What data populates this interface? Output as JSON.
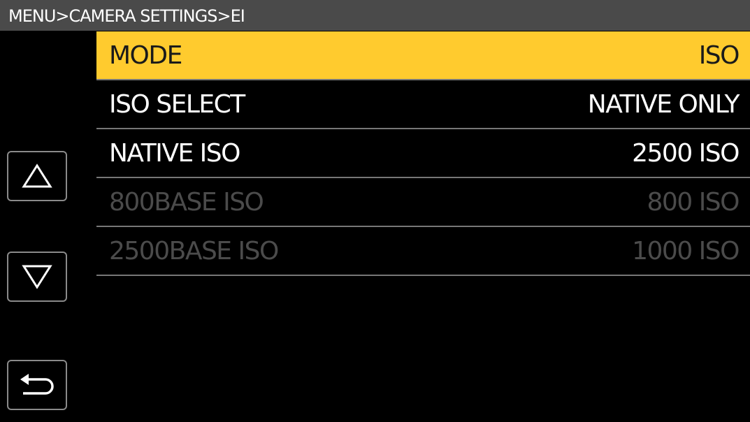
{
  "header": {
    "breadcrumb": "MENU>CAMERA SETTINGS>EI"
  },
  "menu": {
    "items": [
      {
        "label": "MODE",
        "value": "ISO",
        "state": "selected"
      },
      {
        "label": "ISO SELECT",
        "value": "NATIVE ONLY",
        "state": "enabled"
      },
      {
        "label": "NATIVE ISO",
        "value": "2500 ISO",
        "state": "enabled"
      },
      {
        "label": "800BASE ISO",
        "value": "800 ISO",
        "state": "disabled"
      },
      {
        "label": "2500BASE ISO",
        "value": "1000 ISO",
        "state": "disabled"
      }
    ]
  },
  "side_buttons": {
    "up_icon": "triangle-up-icon",
    "down_icon": "triangle-down-icon",
    "back_icon": "return-arrow-icon"
  },
  "colors": {
    "header_bg": "#4a4a4a",
    "selected_bg": "#ffcb2e",
    "disabled_text": "#4b4b4b",
    "divider": "#777777"
  }
}
